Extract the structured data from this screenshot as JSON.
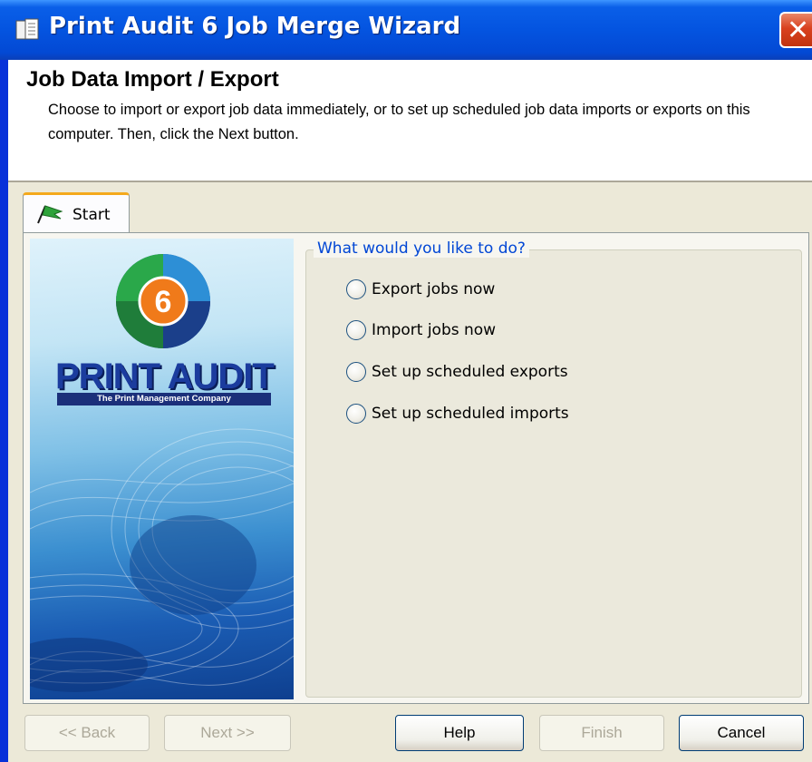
{
  "window": {
    "title": "Print Audit 6 Job Merge Wizard",
    "close_glyph": "✕"
  },
  "header": {
    "title": "Job Data Import / Export",
    "description": "Choose to import or export job data immediately, or to set up scheduled job data imports or exports on this computer.  Then, click the Next button."
  },
  "tab": {
    "label": "Start",
    "icon": "flag-icon"
  },
  "banner": {
    "brand": "PRINT AUDIT",
    "tagline": "The Print Management Company",
    "badge_number": "6"
  },
  "options": {
    "legend": "What would you like to do?",
    "items": [
      {
        "label": "Export jobs now",
        "selected": false
      },
      {
        "label": "Import jobs now",
        "selected": false
      },
      {
        "label": "Set up scheduled exports",
        "selected": false
      },
      {
        "label": "Set up scheduled imports",
        "selected": false
      }
    ]
  },
  "buttons": {
    "back": "<< Back",
    "next": "Next >>",
    "help": "Help",
    "finish": "Finish",
    "cancel": "Cancel"
  },
  "colors": {
    "titlebar": "#0454e0",
    "group_legend": "#0046d5",
    "tab_highlight": "#f4a91d"
  }
}
